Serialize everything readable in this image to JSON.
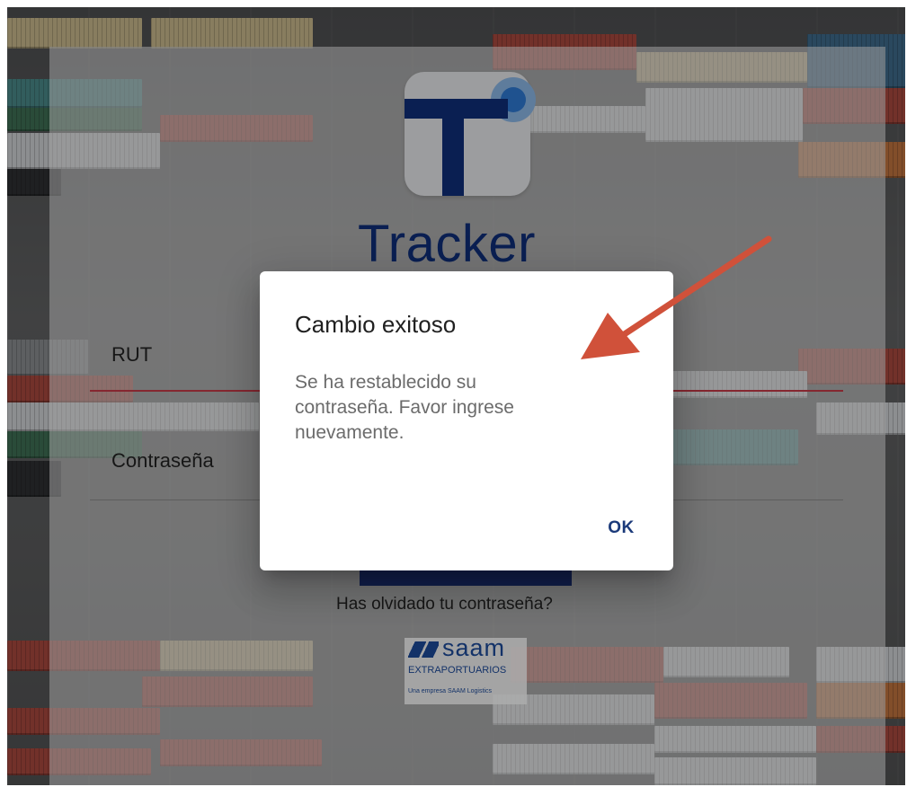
{
  "app": {
    "brand_name": "Tracker",
    "logo_icon": "tracker-t-logo-icon",
    "brand_color": "#0f2f7a"
  },
  "login_form": {
    "rut_label": "RUT",
    "password_label": "Contraseña",
    "forgot_password_link": "Has olvidado tu contraseña?",
    "active_field_line_color": "#c43a47"
  },
  "footer_logo": {
    "name": "saam",
    "subtitle": "EXTRAPORTUARIOS",
    "tagline": "Una empresa SAAM Logistics"
  },
  "dialog": {
    "title": "Cambio exitoso",
    "message": "Se ha restablecido su contraseña. Favor ingrese nuevamente.",
    "ok_label": "OK"
  },
  "annotation": {
    "arrow_color": "#d0513a",
    "arrow_icon": "annotation-arrow-icon"
  }
}
